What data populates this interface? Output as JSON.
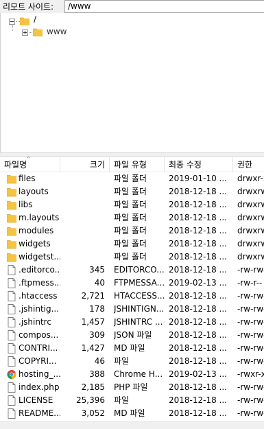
{
  "remote_site": {
    "label": "리모트 사이트:",
    "path": "/www"
  },
  "tree": {
    "root_label": "/",
    "child_label": "www"
  },
  "columns": {
    "name": "파일명",
    "size": "크기",
    "type": "파일 유형",
    "modified": "최종 수정",
    "permissions": "권한"
  },
  "files": [
    {
      "name": "files",
      "size": "",
      "type": "파일 폴더",
      "modified": "2019-01-10 ...",
      "perm": "drwxr-x",
      "icon": "folder-icon"
    },
    {
      "name": "layouts",
      "size": "",
      "type": "파일 폴더",
      "modified": "2018-12-18 ...",
      "perm": "drwxrw",
      "icon": "folder-icon"
    },
    {
      "name": "libs",
      "size": "",
      "type": "파일 폴더",
      "modified": "2018-12-18 ...",
      "perm": "drwxrw",
      "icon": "folder-icon"
    },
    {
      "name": "m.layouts",
      "size": "",
      "type": "파일 폴더",
      "modified": "2018-12-18 ...",
      "perm": "drwxrw",
      "icon": "folder-icon"
    },
    {
      "name": "modules",
      "size": "",
      "type": "파일 폴더",
      "modified": "2018-12-18 ...",
      "perm": "drwxrw",
      "icon": "folder-icon"
    },
    {
      "name": "widgets",
      "size": "",
      "type": "파일 폴더",
      "modified": "2018-12-18 ...",
      "perm": "drwxrw",
      "icon": "folder-icon"
    },
    {
      "name": "widgetst...",
      "size": "",
      "type": "파일 폴더",
      "modified": "2018-12-18 ...",
      "perm": "drwxrw",
      "icon": "folder-icon"
    },
    {
      "name": ".editorco...",
      "size": "345",
      "type": "EDITORCO...",
      "modified": "2018-12-18 ...",
      "perm": "-rw-rw-",
      "icon": "file-icon"
    },
    {
      "name": ".ftpmess...",
      "size": "40",
      "type": "FTPMESSA...",
      "modified": "2019-02-13 ...",
      "perm": "-rw-r--",
      "icon": "file-icon"
    },
    {
      "name": ".htaccess",
      "size": "2,721",
      "type": "HTACCESS...",
      "modified": "2018-12-18 ...",
      "perm": "-rw-rw-",
      "icon": "file-icon"
    },
    {
      "name": ".jshintig...",
      "size": "178",
      "type": "JSHINTIGN...",
      "modified": "2018-12-18 ...",
      "perm": "-rw-rw-",
      "icon": "file-icon"
    },
    {
      "name": ".jshintrc",
      "size": "1,457",
      "type": "JSHINTRC ...",
      "modified": "2018-12-18 ...",
      "perm": "-rw-rw-",
      "icon": "file-icon"
    },
    {
      "name": "compos...",
      "size": "309",
      "type": "JSON 파일",
      "modified": "2018-12-18 ...",
      "perm": "-rw-rw-",
      "icon": "file-icon"
    },
    {
      "name": "CONTRI...",
      "size": "1,427",
      "type": "MD 파일",
      "modified": "2018-12-18 ...",
      "perm": "-rw-rw-",
      "icon": "file-icon"
    },
    {
      "name": "COPYRI...",
      "size": "46",
      "type": "파일",
      "modified": "2018-12-18 ...",
      "perm": "-rw-rw-",
      "icon": "file-icon"
    },
    {
      "name": "hosting_...",
      "size": "388",
      "type": "Chrome H...",
      "modified": "2019-02-13 ...",
      "perm": "-rwxr-x",
      "icon": "chrome-icon"
    },
    {
      "name": "index.php",
      "size": "2,185",
      "type": "PHP 파일",
      "modified": "2018-12-18 ...",
      "perm": "-rw-rw-",
      "icon": "file-icon"
    },
    {
      "name": "LICENSE",
      "size": "25,396",
      "type": "파일",
      "modified": "2018-12-18 ...",
      "perm": "-rw-rw-",
      "icon": "file-icon"
    },
    {
      "name": "README...",
      "size": "3,052",
      "type": "MD 파일",
      "modified": "2018-12-18 ...",
      "perm": "-rw-rw-",
      "icon": "file-icon"
    }
  ],
  "colors": {
    "folder": "#f5c542",
    "folder_dark": "#e0a92a",
    "file_border": "#7a7a7a"
  }
}
